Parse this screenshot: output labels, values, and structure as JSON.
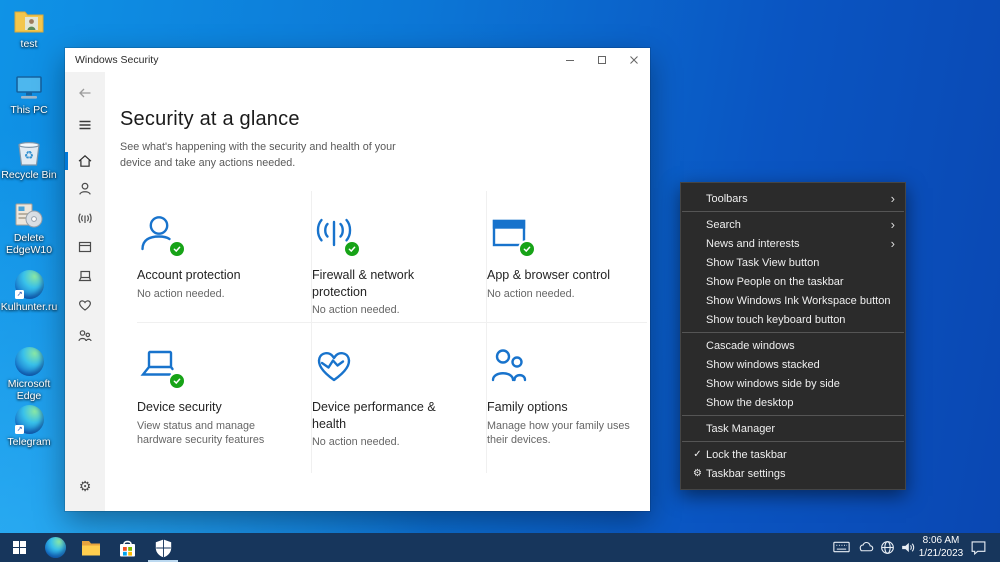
{
  "colors": {
    "accent": "#0078d7",
    "icon_blue": "#1873cc",
    "ok_green": "#17a317",
    "taskbar_bg": "#17365c",
    "menu_bg": "#2b2b2b",
    "desktop_gradient_start": "#0f93e6",
    "desktop_gradient_end": "#0a47b2"
  },
  "desktop": {
    "icons": [
      {
        "label": "test",
        "icon": "folder-with-user-photo"
      },
      {
        "label": "This PC",
        "icon": "computer"
      },
      {
        "label": "Recycle Bin",
        "icon": "recycle-bin"
      },
      {
        "label": "Delete EdgeW10",
        "icon": "installer-package-disc"
      },
      {
        "label": "Kulhunter.ru",
        "icon": "edge-shortcut"
      },
      {
        "label": "Microsoft Edge",
        "icon": "edge"
      },
      {
        "label": "Telegram",
        "icon": "edge-shortcut"
      }
    ]
  },
  "window": {
    "title": "Windows Security",
    "controls": [
      "minimize",
      "maximize",
      "close"
    ],
    "sidebar_icons": [
      "back",
      "menu",
      "home",
      "account-protection",
      "firewall-network",
      "app-browser-control",
      "device-security",
      "device-performance",
      "family-options",
      "settings"
    ],
    "sidebar_selected": "home",
    "page_title": "Security at a glance",
    "page_subtitle": "See what's happening with the security and health of your device and take any actions needed.",
    "tiles": [
      {
        "title": "Account protection",
        "subtitle": "No action needed.",
        "icon": "account-protection",
        "status_ok": true
      },
      {
        "title": "Firewall & network protection",
        "subtitle": "No action needed.",
        "icon": "firewall-network",
        "status_ok": true
      },
      {
        "title": "App & browser control",
        "subtitle": "No action needed.",
        "icon": "app-browser-control",
        "status_ok": true
      },
      {
        "title": "Device security",
        "subtitle": "View status and manage hardware security features",
        "icon": "device-security",
        "status_ok": true
      },
      {
        "title": "Device performance & health",
        "subtitle": "No action needed.",
        "icon": "device-performance",
        "status_ok": false
      },
      {
        "title": "Family options",
        "subtitle": "Manage how your family uses their devices.",
        "icon": "family-options",
        "status_ok": false
      }
    ]
  },
  "context_menu": {
    "items": [
      {
        "label": "Toolbars",
        "submenu": true
      },
      {
        "label": "Search",
        "submenu": true
      },
      {
        "label": "News and interests",
        "submenu": true
      },
      {
        "label": "Show Task View button"
      },
      {
        "label": "Show People on the taskbar"
      },
      {
        "label": "Show Windows Ink Workspace button"
      },
      {
        "label": "Show touch keyboard button"
      },
      {
        "label": "Cascade windows"
      },
      {
        "label": "Show windows stacked"
      },
      {
        "label": "Show windows side by side"
      },
      {
        "label": "Show the desktop"
      },
      {
        "label": "Task Manager"
      },
      {
        "label": "Lock the taskbar",
        "checked": true
      },
      {
        "label": "Taskbar settings",
        "gear": true
      }
    ],
    "glyphs": {
      "check": "✓",
      "gear": "⚙",
      "submenu_arrow": "›"
    }
  },
  "taskbar": {
    "buttons": [
      "start",
      "edge",
      "file-explorer",
      "microsoft-store",
      "windows-security"
    ],
    "active_button": "windows-security",
    "tray_icons": [
      "touch-keyboard",
      "onedrive",
      "network",
      "volume"
    ],
    "clock": {
      "time": "8:06 AM",
      "date": "1/21/2023"
    },
    "action_center": "notifications"
  }
}
